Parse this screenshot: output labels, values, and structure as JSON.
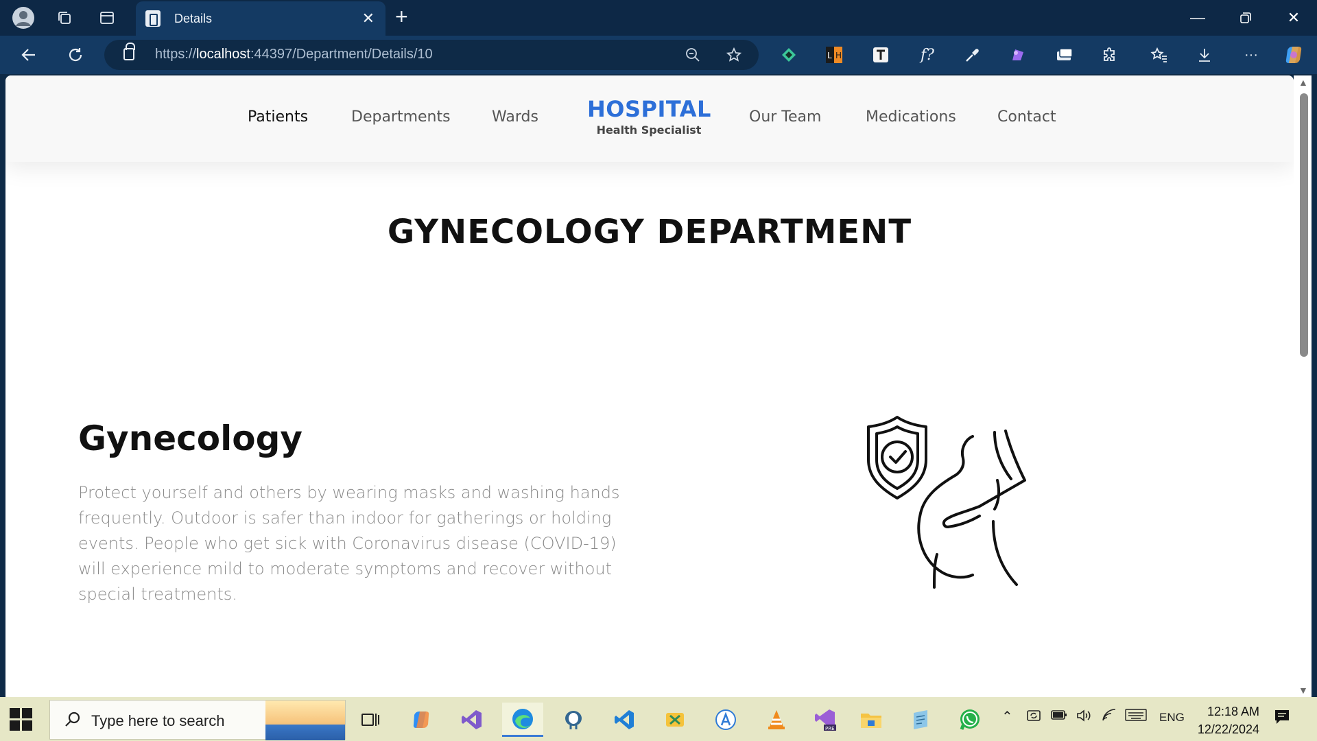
{
  "browser": {
    "tab_title": "Details",
    "url_prefix": "https://",
    "url_host": "localhost",
    "url_rest": ":44397/Department/Details/10"
  },
  "site": {
    "nav": {
      "patients": "Patients",
      "departments": "Departments",
      "wards": "Wards",
      "our_team": "Our Team",
      "medications": "Medications",
      "contact": "Contact"
    },
    "logo": {
      "name": "HOSPITAL",
      "tagline": "Health Specialist"
    },
    "page_title": "GYNECOLOGY DEPARTMENT",
    "section": {
      "heading": "Gynecology",
      "text": "Protect yourself and others by wearing masks and washing hands frequently. Outdoor is safer than indoor for gatherings or holding events. People who get sick with Coronavirus disease (COVID-19) will experience mild to moderate symptoms and recover without special treatments."
    }
  },
  "taskbar": {
    "search_placeholder": "Type here to search",
    "language": "ENG",
    "time": "12:18 AM",
    "date": "12/22/2024"
  },
  "colors": {
    "accent": "#2d6fd8",
    "browser_frame": "#0d2846",
    "taskbar": "#e6e7c6"
  }
}
